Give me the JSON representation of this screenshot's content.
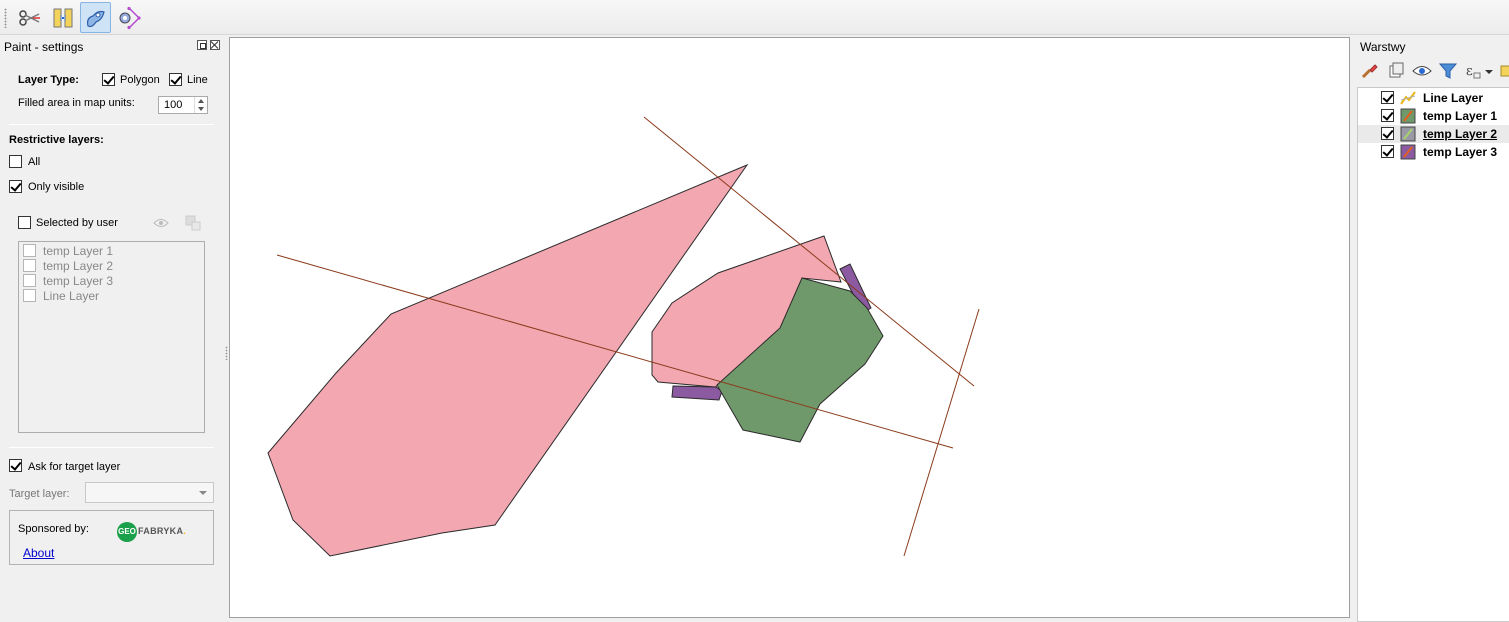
{
  "toolbar": {
    "tools": [
      {
        "icon": "scissors-icon",
        "active": false
      },
      {
        "icon": "split-features-icon",
        "active": false
      },
      {
        "icon": "paint-brush-icon",
        "active": true
      },
      {
        "icon": "vertex-tool-icon",
        "active": false
      }
    ]
  },
  "left_panel": {
    "title": "Paint - settings",
    "layer_type_label": "Layer Type:",
    "polygon_label": "Polygon",
    "polygon_checked": true,
    "line_label": "Line",
    "line_checked": true,
    "filled_area_label": "Filled area in map units:",
    "filled_area_value": "100",
    "restrictive_heading": "Restrictive layers:",
    "all_label": "All",
    "all_checked": false,
    "only_visible_label": "Only visible",
    "only_visible_checked": true,
    "selected_by_user_label": "Selected by user",
    "selected_by_user_checked": false,
    "layer_list": [
      "temp Layer 1",
      "temp Layer 2",
      "temp Layer 3",
      "Line Layer"
    ],
    "ask_target_label": "Ask for target layer",
    "ask_target_checked": true,
    "target_layer_label": "Target layer:",
    "target_layer_value": "",
    "sponsored_by_label": "Sponsored by:",
    "sponsor_logo_prefix": "GEO",
    "sponsor_logo_text": "FABRYKA",
    "sponsor_logo_dot": ".",
    "about_link": "About"
  },
  "map": {
    "colors": {
      "pink_fill": "#f2a7b1",
      "green_fill": "#70996b",
      "purple_fill": "#8c5aa0",
      "line_color": "#8b3a1a",
      "outline": "#2b2b2b"
    }
  },
  "right_panel": {
    "title": "Warstwy",
    "toolbar_icons": [
      "style-brush-icon",
      "add-group-icon",
      "visibility-eye-icon",
      "filter-icon",
      "expression-filter-icon",
      "dropdown-arrow-icon",
      "collapse-icon"
    ],
    "layers": [
      {
        "name": "Line Layer",
        "checked": true,
        "icon": "line-layer-icon",
        "selected": false,
        "underlined": false
      },
      {
        "name": "temp Layer 1",
        "checked": true,
        "icon": "polygon-layer-green-icon",
        "selected": false,
        "underlined": false
      },
      {
        "name": "temp Layer 2",
        "checked": true,
        "icon": "polygon-layer-grey-icon",
        "selected": true,
        "underlined": true
      },
      {
        "name": "temp Layer 3",
        "checked": true,
        "icon": "polygon-layer-purple-icon",
        "selected": false,
        "underlined": false
      }
    ]
  }
}
